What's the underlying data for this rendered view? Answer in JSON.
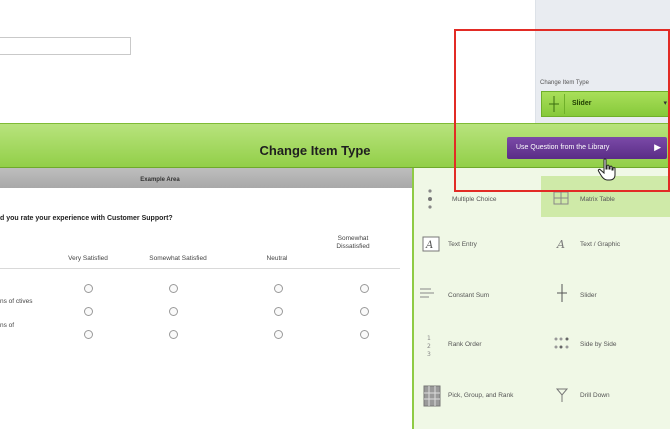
{
  "top": {
    "change_item_type_label": "Change Item Type",
    "selected_type": "Slider",
    "caret": "▾"
  },
  "toolbar": {
    "title": "Change Item Type",
    "library_button": "Use Question from the Library",
    "library_arrow": "▶"
  },
  "example": {
    "header": "Example Area",
    "question": "d you rate your experience with Customer Support?",
    "columns": [
      "Very Satisfied",
      "Somewhat Satisfied",
      "Neutral",
      "Somewhat Dissatisfied"
    ],
    "rows": [
      "ns of ctives",
      "ns of",
      ""
    ]
  },
  "library": {
    "items": [
      {
        "label": "Multiple Choice",
        "icon": "multiple-choice-icon"
      },
      {
        "label": "Matrix Table",
        "icon": "matrix-table-icon"
      },
      {
        "label": "Text Entry",
        "icon": "text-entry-icon"
      },
      {
        "label": "Text / Graphic",
        "icon": "text-graphic-icon"
      },
      {
        "label": "Constant Sum",
        "icon": "constant-sum-icon"
      },
      {
        "label": "Slider",
        "icon": "slider-icon"
      },
      {
        "label": "Rank Order",
        "icon": "rank-order-icon"
      },
      {
        "label": "Side by Side",
        "icon": "side-by-side-icon"
      },
      {
        "label": "Pick, Group, and Rank",
        "icon": "pick-group-rank-icon"
      },
      {
        "label": "Drill Down",
        "icon": "drill-down-icon"
      }
    ]
  },
  "colors": {
    "accent_green": "#92cf48",
    "library_purple": "#5a2d86",
    "highlight_red": "#e22b25"
  }
}
